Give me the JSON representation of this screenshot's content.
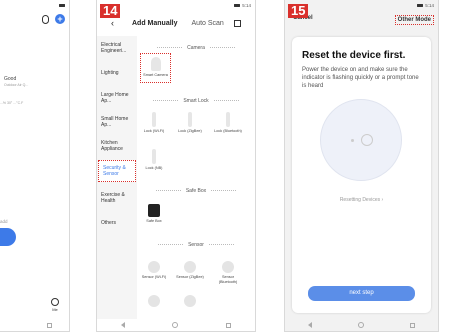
{
  "panel1": {
    "weather": {
      "condition": "Good",
      "detail": "Outdoor Air Q..."
    },
    "stats": "...%  30°   ...°C.F",
    "add_text": "add",
    "tab_me": "Me"
  },
  "panel2": {
    "step": "14",
    "status": "5:14",
    "tabs": {
      "manual": "Add Manually",
      "auto": "Auto Scan"
    },
    "categories": [
      "Electrical Engineeri...",
      "Lighting",
      "Large Home Ap...",
      "Small Home Ap...",
      "Kitchen Appliance",
      "Security & Sensor",
      "Exercise & Health",
      "Others"
    ],
    "sections": {
      "camera": "Camera",
      "smart_lock": "Smart Lock",
      "safe_box": "Safe Box",
      "sensor": "Sensor"
    },
    "devices": {
      "smart_camera": "Smart Camera",
      "lock_wifi": "Lock (Wi-Fi)",
      "lock_zigbee": "Lock (ZigBee)",
      "lock_bluetooth": "Lock (Bluetooth)",
      "lock_nb": "Lock (NB)",
      "safe_box": "Safe Box",
      "sensor_wifi": "Sensor (Wi-Fi)",
      "sensor_zigbee": "Sensor (ZigBee)",
      "sensor_bluetooth": "Sensor (Bluetooth)"
    }
  },
  "panel3": {
    "step": "15",
    "status": "5:14",
    "cancel": "Cancel",
    "other_mode": "Other Mode",
    "title": "Reset the device first.",
    "description": "Power the device on and make sure the indicator is flashing quickly or a prompt tone is heard",
    "resetting": "Resetting Devices",
    "next_step": "next step"
  },
  "colors": {
    "accent": "#3d7ae8",
    "highlight": "#d9302c"
  }
}
